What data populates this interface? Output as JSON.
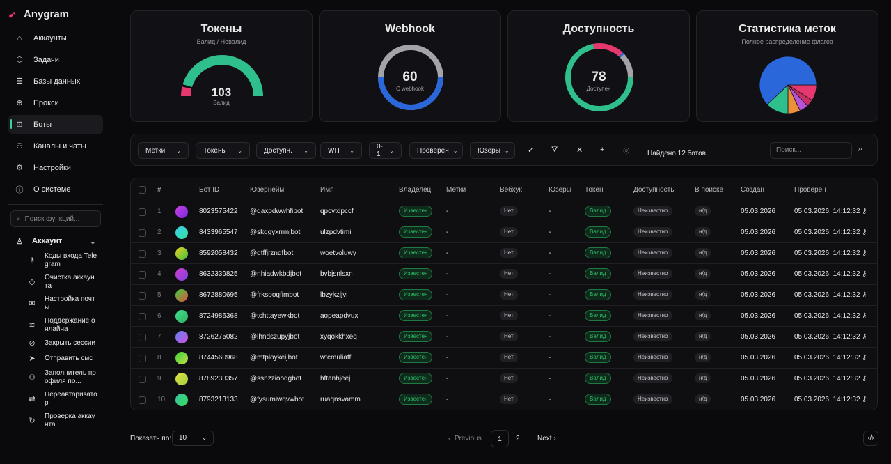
{
  "app": {
    "name": "Anygram"
  },
  "sidebar": {
    "items": [
      {
        "label": "Аккаунты",
        "icon": "home-icon",
        "glyph": "⌂"
      },
      {
        "label": "Задачи",
        "icon": "cube-icon",
        "glyph": "⬡"
      },
      {
        "label": "Базы данных",
        "icon": "database-icon",
        "glyph": "☰"
      },
      {
        "label": "Прокси",
        "icon": "globe-icon",
        "glyph": "⊕"
      },
      {
        "label": "Боты",
        "icon": "bot-icon",
        "glyph": "⊡",
        "active": true
      },
      {
        "label": "Каналы и чаты",
        "icon": "users-icon",
        "glyph": "⚇"
      },
      {
        "label": "Настройки",
        "icon": "gear-icon",
        "glyph": "⚙"
      },
      {
        "label": "О системе",
        "icon": "info-icon",
        "glyph": "ⓘ"
      }
    ],
    "search_placeholder": "Поиск функций...",
    "section": {
      "label": "Аккаунт",
      "icon": "user-icon"
    },
    "sub_items": [
      {
        "label": "Коды входа Telegram",
        "icon": "key-icon",
        "glyph": "⚷"
      },
      {
        "label": "Очистка аккаунта",
        "icon": "eraser-icon",
        "glyph": "◇"
      },
      {
        "label": "Настройка почты",
        "icon": "mail-icon",
        "glyph": "✉"
      },
      {
        "label": "Поддержание онлайна",
        "icon": "wifi-icon",
        "glyph": "≋"
      },
      {
        "label": "Закрыть сессии",
        "icon": "shield-off-icon",
        "glyph": "⊘"
      },
      {
        "label": "Отправить смс",
        "icon": "send-icon",
        "glyph": "➤"
      },
      {
        "label": "Заполнитель профиля по...",
        "icon": "user-cog-icon",
        "glyph": "⚇"
      },
      {
        "label": "Переавторизатор",
        "icon": "repeat-icon",
        "glyph": "⇄"
      },
      {
        "label": "Проверка аккаунта",
        "icon": "refresh-icon",
        "glyph": "↻"
      }
    ]
  },
  "stats": {
    "tokens": {
      "title": "Токены",
      "subtitle": "Валид / Невалид",
      "value": "103",
      "label": "Валид",
      "valid": 103,
      "invalid": 9,
      "colors": {
        "valid": "#2fbf8c",
        "invalid": "#e5386f"
      }
    },
    "webhook": {
      "title": "Webhook",
      "value": "60",
      "label": "С webhook",
      "with_fraction": 0.5,
      "colors": {
        "with": "#2a67db",
        "without": "#a3a3a8"
      }
    },
    "availability": {
      "title": "Доступность",
      "value": "78",
      "label": "Доступен",
      "segments": [
        {
          "fraction": 0.72,
          "color": "#2fbf8c"
        },
        {
          "fraction": 0.15,
          "color": "#e5386f"
        },
        {
          "fraction": 0.01,
          "color": "#2a67db"
        },
        {
          "fraction": 0.12,
          "color": "#a3a3a8"
        }
      ]
    },
    "flags": {
      "title": "Статистика меток",
      "subtitle": "Полное распределение флагов"
    }
  },
  "chart_data": {
    "type": "pie",
    "values": [
      9,
      4,
      5,
      7,
      13,
      62
    ],
    "colors": [
      "#e5386f",
      "#c92f62",
      "#b653d9",
      "#ec913a",
      "#2fbf8c",
      "#2a67db"
    ]
  },
  "filters": {
    "dropdowns": [
      "Метки",
      "Токены",
      "Доступн.",
      "WH",
      "0-1",
      "Проверен",
      "Юзеры"
    ],
    "found": "Найдено 12 ботов",
    "search_placeholder": "Поиск..."
  },
  "table": {
    "columns": [
      "#",
      "Бот ID",
      "Юзернейм",
      "Имя",
      "Владелец",
      "Метки",
      "Вебхук",
      "Юзеры",
      "Токен",
      "Доступность",
      "В поиске",
      "Создан",
      "Проверен"
    ],
    "rows": [
      {
        "n": "1",
        "id": "8023575422",
        "username": "@qaxpdwwhfibot",
        "name": "qpcvtdpccf",
        "avatar": [
          "#c940e0",
          "#7a2be0"
        ]
      },
      {
        "n": "2",
        "id": "8433965547",
        "username": "@skggyxrrmjbot",
        "name": "ulzpdvtimi",
        "avatar": [
          "#3fd0e8",
          "#2fe0a0"
        ]
      },
      {
        "n": "3",
        "id": "8592058432",
        "username": "@qtffjrzndfbot",
        "name": "woetvoluwy",
        "avatar": [
          "#e8d020",
          "#40c040"
        ]
      },
      {
        "n": "4",
        "id": "8632339825",
        "username": "@nhiadwkbdjbot",
        "name": "bvbjsnlsxn",
        "avatar": [
          "#d040d0",
          "#8040e0"
        ]
      },
      {
        "n": "5",
        "id": "8672880695",
        "username": "@frksooqfimbot",
        "name": "lbzykzljvl",
        "avatar": [
          "#40d040",
          "#e05040"
        ]
      },
      {
        "n": "6",
        "id": "8724986368",
        "username": "@tchttayewkbot",
        "name": "aopeapdvux",
        "avatar": [
          "#40e090",
          "#30b060"
        ]
      },
      {
        "n": "7",
        "id": "8726275082",
        "username": "@ihndszupyjbot",
        "name": "xyqokkhxeq",
        "avatar": [
          "#6080f0",
          "#d050e0"
        ]
      },
      {
        "n": "8",
        "id": "8744560968",
        "username": "@mtploykeijbot",
        "name": "wtcmuliaff",
        "avatar": [
          "#40d040",
          "#c0e040"
        ]
      },
      {
        "n": "9",
        "id": "8789233357",
        "username": "@ssnzzioodgbot",
        "name": "hftanhjeej",
        "avatar": [
          "#e0e040",
          "#a0d040"
        ]
      },
      {
        "n": "10",
        "id": "8793213133",
        "username": "@fysumiwqvwbot",
        "name": "ruaqnsvamm",
        "avatar": [
          "#40c0a0",
          "#30e060"
        ]
      }
    ],
    "owner": "Известен",
    "tags": "-",
    "webhook": "Нет",
    "users": "-",
    "token": "Валид",
    "availability": "Неизвестно",
    "in_search": "н/д",
    "created": "05.03.2026",
    "checked": "05.03.2026, 14:12:32"
  },
  "pagination": {
    "page_size_label": "Показать по:",
    "page_size": "10",
    "previous": "Previous",
    "next": "Next",
    "pages": [
      "1",
      "2"
    ],
    "current": "1"
  }
}
